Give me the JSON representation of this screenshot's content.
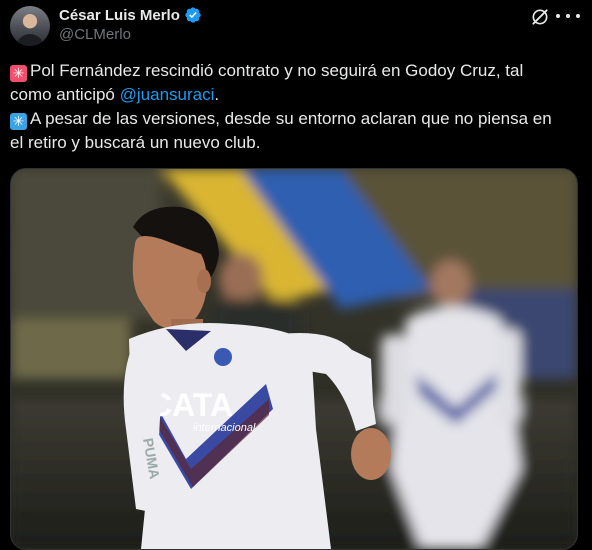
{
  "author": {
    "display_name": "César Luis Merlo",
    "handle": "@CLMerlo",
    "verified": true
  },
  "tweet": {
    "line1_text": "Pol Fernández rescindió contrato y no seguirá en Godoy Cruz, tal",
    "line2_text": "como anticipó ",
    "line2_mention": "@juansuraci",
    "line2_end": ".",
    "line3_text": "A pesar de las versiones, desde su entorno aclaran que no piensa en",
    "line4_text": "el retiro y buscará un nuevo club.",
    "emoji1": "✳",
    "emoji2": "✳"
  },
  "media": {
    "sponsor_text": "CATA",
    "sponsor_sub": "internacional"
  },
  "icons": {
    "grok": "grok-icon",
    "more": "more-icon",
    "verified": "verified-badge-icon"
  },
  "colors": {
    "background": "#000000",
    "text": "#e7e9ea",
    "secondary_text": "#71767b",
    "link": "#1d9bf0",
    "verified": "#1d9bf0"
  }
}
